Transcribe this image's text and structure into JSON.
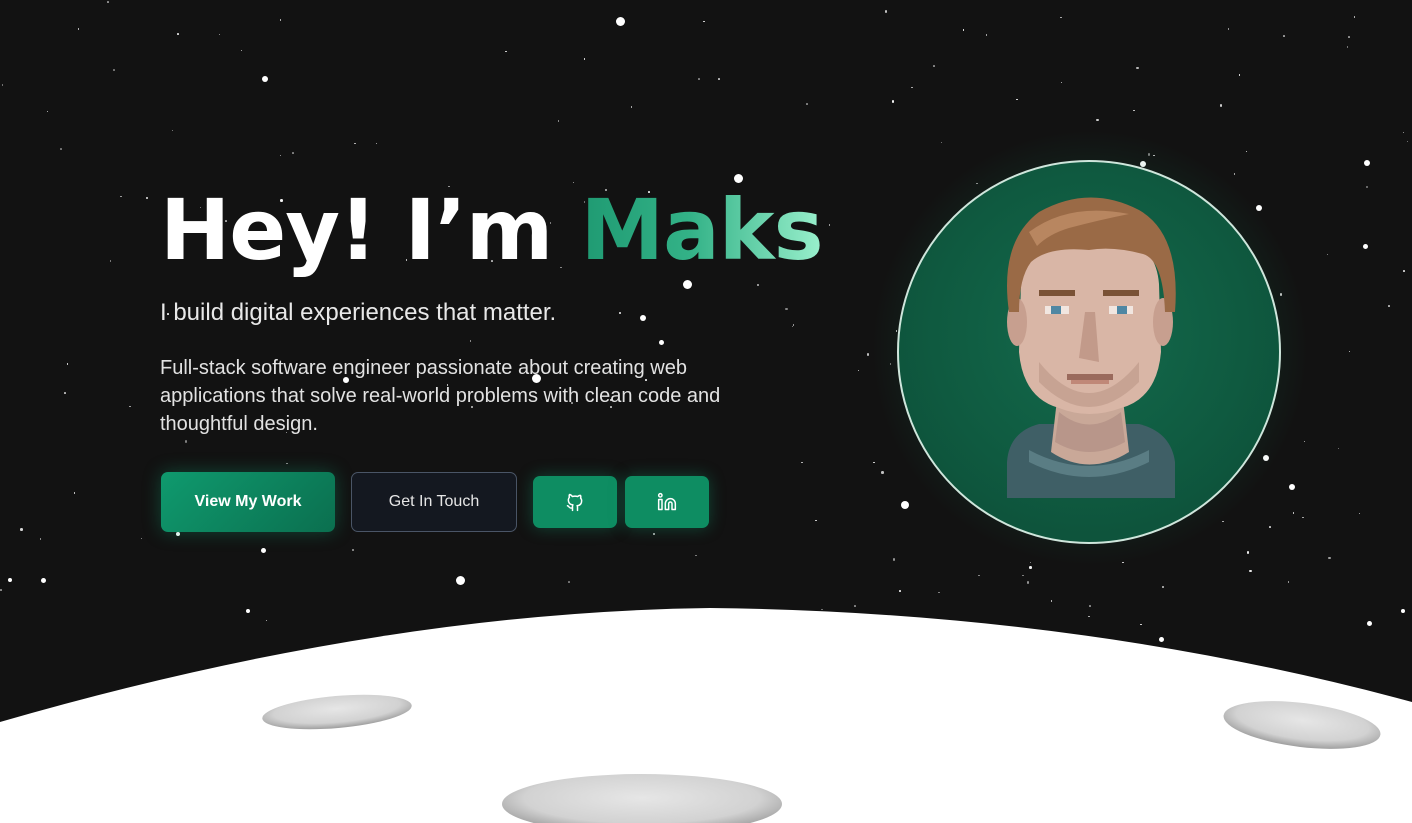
{
  "hero": {
    "greeting": "Hey! I’m ",
    "name": "Maks",
    "tagline": "I build digital experiences that matter.",
    "description": "Full-stack software engineer passionate about creating web applications that solve real-world problems with clean code and thoughtful design."
  },
  "actions": {
    "view_work": "View My Work",
    "get_in_touch": "Get In Touch",
    "github_icon": "github-icon",
    "linkedin_icon": "linkedin-icon"
  },
  "portrait": {
    "icon": "pixel-art-avatar"
  },
  "colors": {
    "background": "#121212",
    "accent": "#0e8d62",
    "accent_light": "#9af0cd",
    "moon": "#ffffff",
    "crater": "#dcdcdc"
  }
}
